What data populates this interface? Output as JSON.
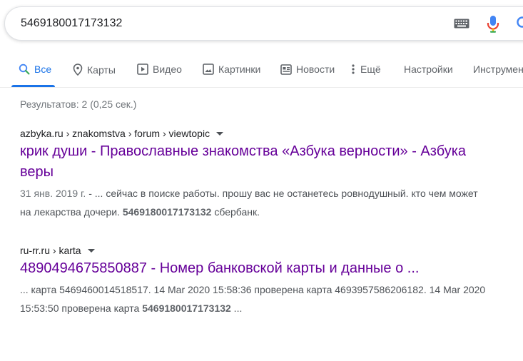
{
  "search": {
    "query": "5469180017173132"
  },
  "tabs": [
    {
      "label": "Все",
      "icon": "search-icon"
    },
    {
      "label": "Карты",
      "icon": "map-pin-icon"
    },
    {
      "label": "Видео",
      "icon": "video-icon"
    },
    {
      "label": "Картинки",
      "icon": "image-icon"
    },
    {
      "label": "Новости",
      "icon": "news-icon"
    },
    {
      "label": "Ещё",
      "icon": "more-vertical-icon"
    },
    {
      "label": "Настройки"
    },
    {
      "label": "Инструменты"
    }
  ],
  "stats": "Результатов: 2 (0,25 сек.)",
  "results": [
    {
      "cite": "azbyka.ru › znakomstva › forum › viewtopic",
      "title": "крик души - Православные знакомства «Азбука верности» - Азбука веры",
      "date": "31 янв. 2019 г.",
      "snippet_before": " - ... сейчас в поиске работы. прошу вас не останетесь ровнодушный. кто чем может на лекарства дочери. ",
      "snippet_bold": "5469180017173132",
      "snippet_after": " сбербанк."
    },
    {
      "cite": "ru-rr.ru › karta",
      "title": "4890494675850887 - Номер банковской карты и данные о ...",
      "snippet_before": "... карта 5469460014518517. 14 Mar 2020 15:58:36 проверена карта 4693957586206182. 14 Mar 2020 15:53:50 проверена карта ",
      "snippet_bold": "5469180017173132",
      "snippet_after": " ..."
    }
  ],
  "colors": {
    "accent": "#1a73e8",
    "visited_link": "#660099"
  }
}
